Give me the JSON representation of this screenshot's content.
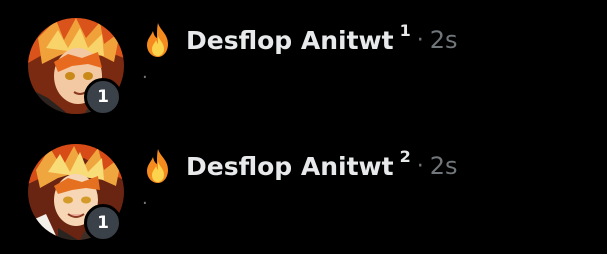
{
  "posts": [
    {
      "display_name": "Desflop Anitwt",
      "superscript": "1",
      "separator": "·",
      "time": "2s",
      "text": ".",
      "avatar_badge_count": "1",
      "name_icon": "fire-icon",
      "avatar_icon": "anime-character-avatar"
    },
    {
      "display_name": "Desflop Anitwt",
      "superscript": "2",
      "separator": "·",
      "time": "2s",
      "text": ".",
      "avatar_badge_count": "1",
      "name_icon": "fire-icon",
      "avatar_icon": "anime-character-avatar"
    }
  ],
  "colors": {
    "background": "#000000",
    "primary_text": "#e7e9ea",
    "secondary_text": "#71767b",
    "badge_background": "#3a4148"
  }
}
